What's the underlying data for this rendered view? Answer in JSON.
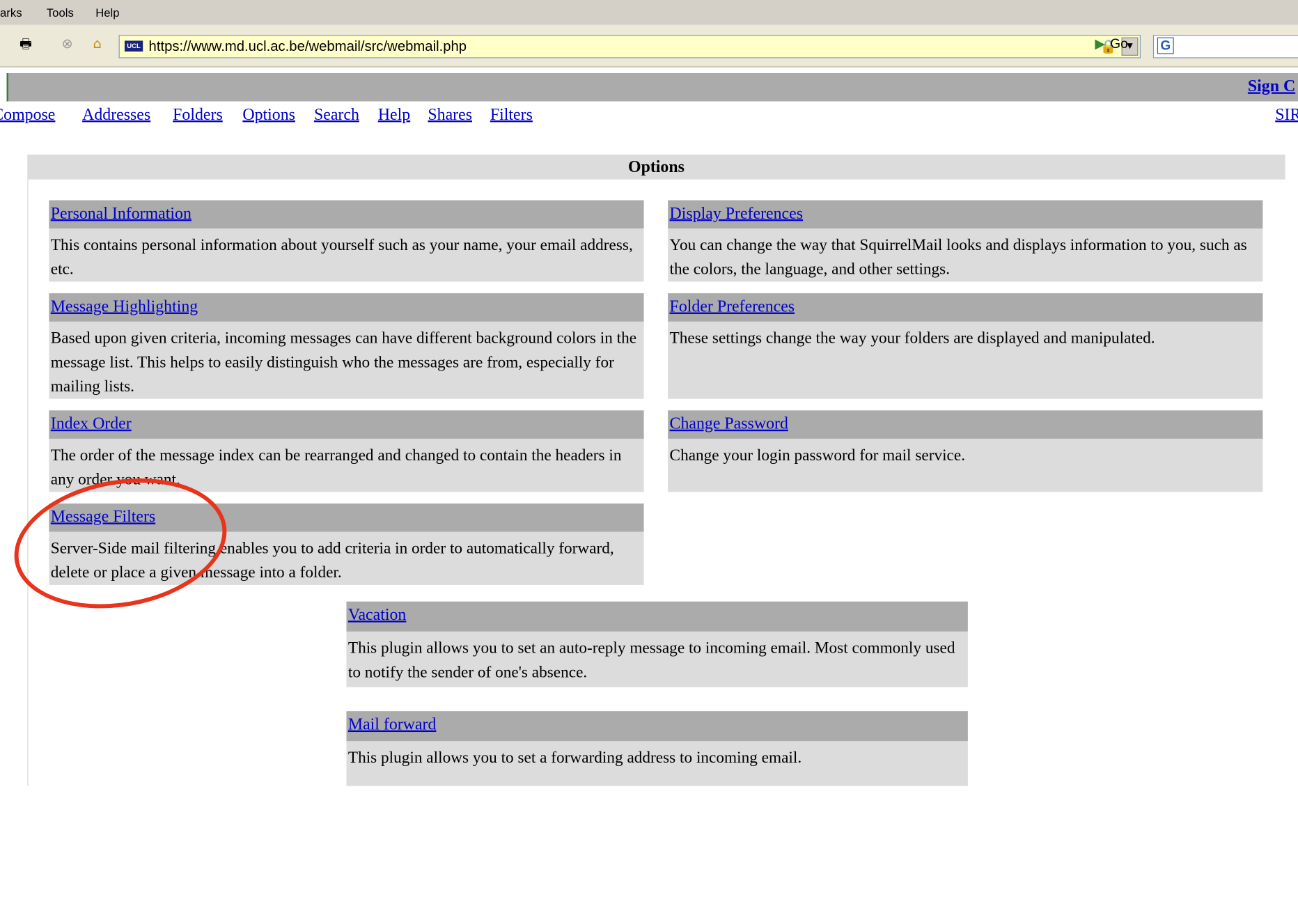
{
  "browser": {
    "menu": {
      "bookmarks_fragment": "arks",
      "tools": "Tools",
      "help": "Help"
    },
    "url": "https://www.md.ucl.ac.be/webmail/src/webmail.php",
    "url_favicon": "UCL",
    "go_label": "Go",
    "search_engine_icon": "G",
    "icons": [
      "print-icon",
      "stop-icon",
      "home-icon",
      "lock-icon",
      "go-icon"
    ]
  },
  "webmail": {
    "signout_label": "Sign C",
    "right_link_label": "SIR",
    "nav": [
      "Compose",
      "Addresses",
      "Folders",
      "Options",
      "Search",
      "Help",
      "Shares",
      "Filters"
    ],
    "options_title": "Options",
    "sections": [
      {
        "title": "Personal Information",
        "desc": "This contains personal information about yourself such as your name, your email address, etc."
      },
      {
        "title": "Display Preferences",
        "desc": "You can change the way that SquirrelMail looks and displays information to you, such as the colors, the language, and other settings."
      },
      {
        "title": "Message Highlighting",
        "desc": "Based upon given criteria, incoming messages can have different background colors in the message list. This helps to easily distinguish who the messages are from, especially for mailing lists."
      },
      {
        "title": "Folder Preferences",
        "desc": "These settings change the way your folders are displayed and manipulated."
      },
      {
        "title": "Index Order",
        "desc": "The order of the message index can be rearranged and changed to contain the headers in any order you want."
      },
      {
        "title": "Change Password",
        "desc": "Change your login password for mail service."
      },
      {
        "title": "Message Filters",
        "desc": "Server-Side mail filtering enables you to add criteria in order to automatically forward, delete or place a given message into a folder."
      },
      {
        "title": "Vacation",
        "desc": "This plugin allows you to set an auto-reply message to incoming email. Most commonly used to notify the sender of one's absence."
      },
      {
        "title": "Mail forward",
        "desc": "This plugin allows you to set a forwarding address to incoming email."
      }
    ],
    "annotation_color": "#e8341c"
  }
}
